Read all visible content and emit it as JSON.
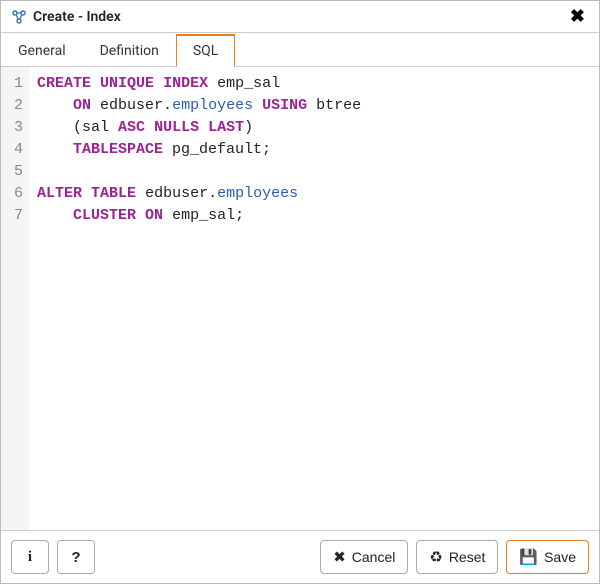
{
  "dialog": {
    "title": "Create - Index"
  },
  "tabs": [
    {
      "id": "general",
      "label": "General",
      "active": false
    },
    {
      "id": "definition",
      "label": "Definition",
      "active": false
    },
    {
      "id": "sql",
      "label": "SQL",
      "active": true
    }
  ],
  "sql": {
    "line_count": 7,
    "lines": [
      {
        "n": 1,
        "tokens": [
          {
            "t": "kw",
            "v": "CREATE"
          },
          {
            "t": "sp",
            "v": " "
          },
          {
            "t": "kw",
            "v": "UNIQUE"
          },
          {
            "t": "sp",
            "v": " "
          },
          {
            "t": "kw",
            "v": "INDEX"
          },
          {
            "t": "sp",
            "v": " "
          },
          {
            "t": "txt",
            "v": "emp_sal"
          }
        ]
      },
      {
        "n": 2,
        "tokens": [
          {
            "t": "sp",
            "v": "    "
          },
          {
            "t": "kw",
            "v": "ON"
          },
          {
            "t": "sp",
            "v": " "
          },
          {
            "t": "txt",
            "v": "edbuser."
          },
          {
            "t": "obj",
            "v": "employees"
          },
          {
            "t": "sp",
            "v": " "
          },
          {
            "t": "kw",
            "v": "USING"
          },
          {
            "t": "sp",
            "v": " "
          },
          {
            "t": "txt",
            "v": "btree"
          }
        ]
      },
      {
        "n": 3,
        "tokens": [
          {
            "t": "sp",
            "v": "    "
          },
          {
            "t": "txt",
            "v": "(sal "
          },
          {
            "t": "kw",
            "v": "ASC"
          },
          {
            "t": "sp",
            "v": " "
          },
          {
            "t": "kw",
            "v": "NULLS"
          },
          {
            "t": "sp",
            "v": " "
          },
          {
            "t": "kw",
            "v": "LAST"
          },
          {
            "t": "txt",
            "v": ")"
          }
        ]
      },
      {
        "n": 4,
        "tokens": [
          {
            "t": "sp",
            "v": "    "
          },
          {
            "t": "kw",
            "v": "TABLESPACE"
          },
          {
            "t": "sp",
            "v": " "
          },
          {
            "t": "txt",
            "v": "pg_default;"
          }
        ]
      },
      {
        "n": 5,
        "tokens": []
      },
      {
        "n": 6,
        "tokens": [
          {
            "t": "kw",
            "v": "ALTER"
          },
          {
            "t": "sp",
            "v": " "
          },
          {
            "t": "kw",
            "v": "TABLE"
          },
          {
            "t": "sp",
            "v": " "
          },
          {
            "t": "txt",
            "v": "edbuser."
          },
          {
            "t": "obj",
            "v": "employees"
          }
        ]
      },
      {
        "n": 7,
        "tokens": [
          {
            "t": "sp",
            "v": "    "
          },
          {
            "t": "kw",
            "v": "CLUSTER"
          },
          {
            "t": "sp",
            "v": " "
          },
          {
            "t": "kw",
            "v": "ON"
          },
          {
            "t": "sp",
            "v": " "
          },
          {
            "t": "txt",
            "v": "emp_sal;"
          }
        ]
      }
    ]
  },
  "footer": {
    "info_label": "i",
    "help_label": "?",
    "cancel_label": "Cancel",
    "reset_label": "Reset",
    "save_label": "Save"
  },
  "icons": {
    "cancel_glyph": "✖",
    "reset_glyph": "♻",
    "save_glyph": "💾",
    "close_glyph": "✖"
  }
}
